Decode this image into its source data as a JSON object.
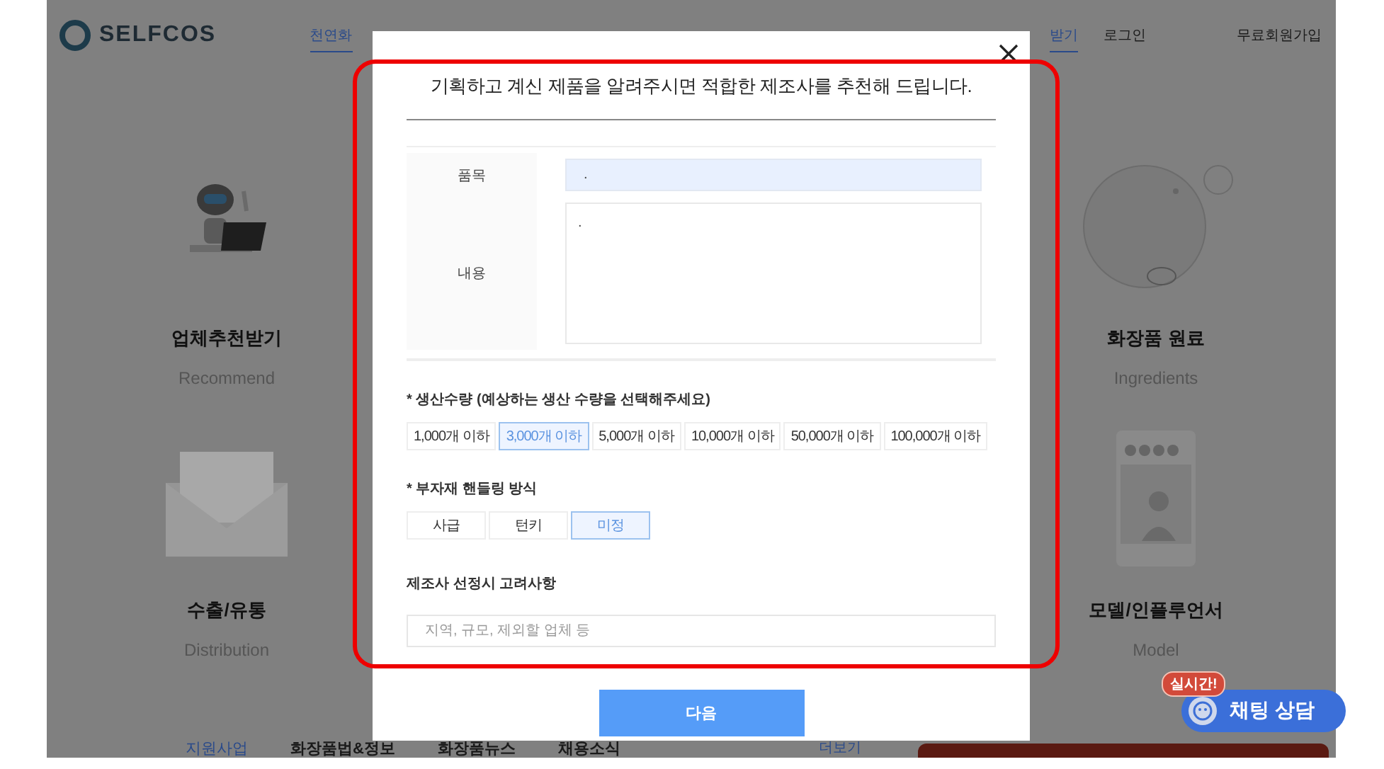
{
  "header": {
    "logo": "SELFCOS",
    "nav": [
      {
        "label": "천연화",
        "selected": true
      },
      {
        "label": "받기",
        "selected": true
      }
    ],
    "account": [
      "로그인",
      "무료회원가입"
    ]
  },
  "services": [
    {
      "kind": "robot",
      "title": "업체추천받기",
      "subtitle": "Recommend"
    },
    {
      "kind": "bubble",
      "title": "화장품 원료",
      "subtitle": "Ingredients"
    },
    {
      "kind": "envelope",
      "title": "수출/유통",
      "subtitle": "Distribution"
    },
    {
      "kind": "phone",
      "title": "모델/인플루언서",
      "subtitle": "Model"
    }
  ],
  "bottom_links": [
    "지원사업",
    "화장품법&정보",
    "화장품뉴스",
    "채용소식"
  ],
  "more_link": "더보기",
  "chat": {
    "badge": "실시간!",
    "label": "채팅 상담"
  },
  "modal": {
    "title": "기획하고 계신 제품을 알려주시면 적합한 제조사를 추천해 드립니다.",
    "fields": [
      {
        "kind": "input",
        "label": "품목",
        "value": "."
      },
      {
        "kind": "textarea",
        "label": "내용",
        "value": "."
      }
    ],
    "quantity": {
      "label": "* 생산수량 (예상하는 생산 수량을 선택해주세요)",
      "options": [
        {
          "label": "1,000개 이하",
          "selected": false
        },
        {
          "label": "3,000개 이하",
          "selected": true
        },
        {
          "label": "5,000개 이하",
          "selected": false
        },
        {
          "label": "10,000개 이하",
          "selected": false
        },
        {
          "label": "50,000개 이하",
          "selected": false
        },
        {
          "label": "100,000개 이하",
          "selected": false
        }
      ]
    },
    "handling": {
      "label": "* 부자재 핸들링 방식",
      "options": [
        {
          "label": "사급",
          "selected": false
        },
        {
          "label": "턴키",
          "selected": false
        },
        {
          "label": "미정",
          "selected": true
        }
      ]
    },
    "considerations": {
      "label": "제조사 선정시 고려사항",
      "placeholder": "지역, 규모, 제외할 업체 등"
    },
    "next_button": "다음"
  }
}
